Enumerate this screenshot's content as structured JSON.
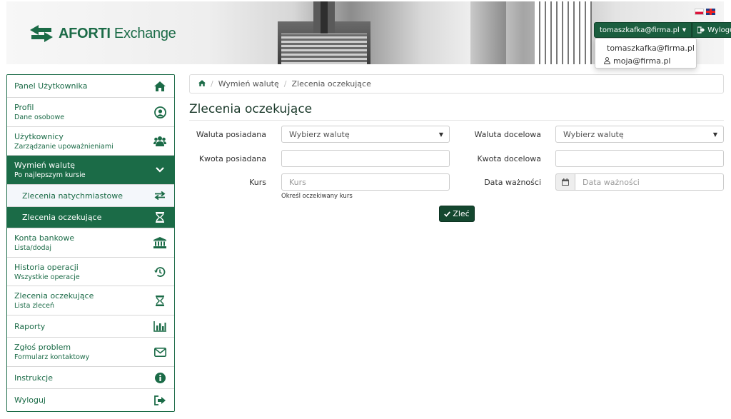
{
  "brand": {
    "name_bold": "AFORTI",
    "name_rest": "Exchange"
  },
  "header": {
    "user_email": "tomaszkafka@firma.pl",
    "logout_label": "Wyloguj",
    "dropdown": [
      {
        "label": "tomaszkafka@firma.pl",
        "icon": "user-icon"
      },
      {
        "label": "moja@firma.pl",
        "icon": "user-outline-icon"
      }
    ],
    "languages": [
      "pl",
      "en"
    ]
  },
  "sidebar": {
    "items": [
      {
        "title": "Panel Użytkownika",
        "subtitle": "",
        "icon": "home-icon"
      },
      {
        "title": "Profil",
        "subtitle": "Dane osobowe",
        "icon": "user-circle-icon"
      },
      {
        "title": "Użytkownicy",
        "subtitle": "Zarządzanie upoważnieniami",
        "icon": "users-icon"
      },
      {
        "title": "Wymień walutę",
        "subtitle": "Po najlepszym kursie",
        "icon": "chevron-down-icon"
      },
      {
        "title": "Zlecenia natychmiastowe",
        "subtitle": "",
        "icon": "exchange-icon"
      },
      {
        "title": "Zlecenia oczekujące",
        "subtitle": "",
        "icon": "hourglass-icon"
      },
      {
        "title": "Konta bankowe",
        "subtitle": "Lista/dodaj",
        "icon": "bank-icon"
      },
      {
        "title": "Historia operacji",
        "subtitle": "Wszystkie operacje",
        "icon": "history-icon"
      },
      {
        "title": "Zlecenia oczekujące",
        "subtitle": "Lista zleceń",
        "icon": "hourglass-icon"
      },
      {
        "title": "Raporty",
        "subtitle": "",
        "icon": "bar-chart-icon"
      },
      {
        "title": "Zgłoś problem",
        "subtitle": "Formularz kontaktowy",
        "icon": "envelope-icon"
      },
      {
        "title": "Instrukcje",
        "subtitle": "",
        "icon": "info-icon"
      },
      {
        "title": "Wyloguj",
        "subtitle": "",
        "icon": "sign-out-icon"
      }
    ]
  },
  "breadcrumb": {
    "items": [
      "Wymień walutę",
      "Zlecenia oczekujące"
    ]
  },
  "page": {
    "title": "Zlecenia oczekujące",
    "form": {
      "source_currency_label": "Waluta posiadana",
      "source_currency_value": "Wybierz walutę",
      "target_currency_label": "Waluta docelowa",
      "target_currency_value": "Wybierz walutę",
      "source_amount_label": "Kwota posiadana",
      "source_amount_value": "",
      "target_amount_label": "Kwota docelowa",
      "target_amount_value": "",
      "rate_label": "Kurs",
      "rate_placeholder": "Kurs",
      "rate_help": "Określ oczekiwany kurs",
      "expiry_label": "Data ważności",
      "expiry_placeholder": "Data ważności",
      "submit_label": "Zleć"
    }
  },
  "colors": {
    "brand_green": "#1b6b47",
    "dark_green": "#14472f"
  }
}
